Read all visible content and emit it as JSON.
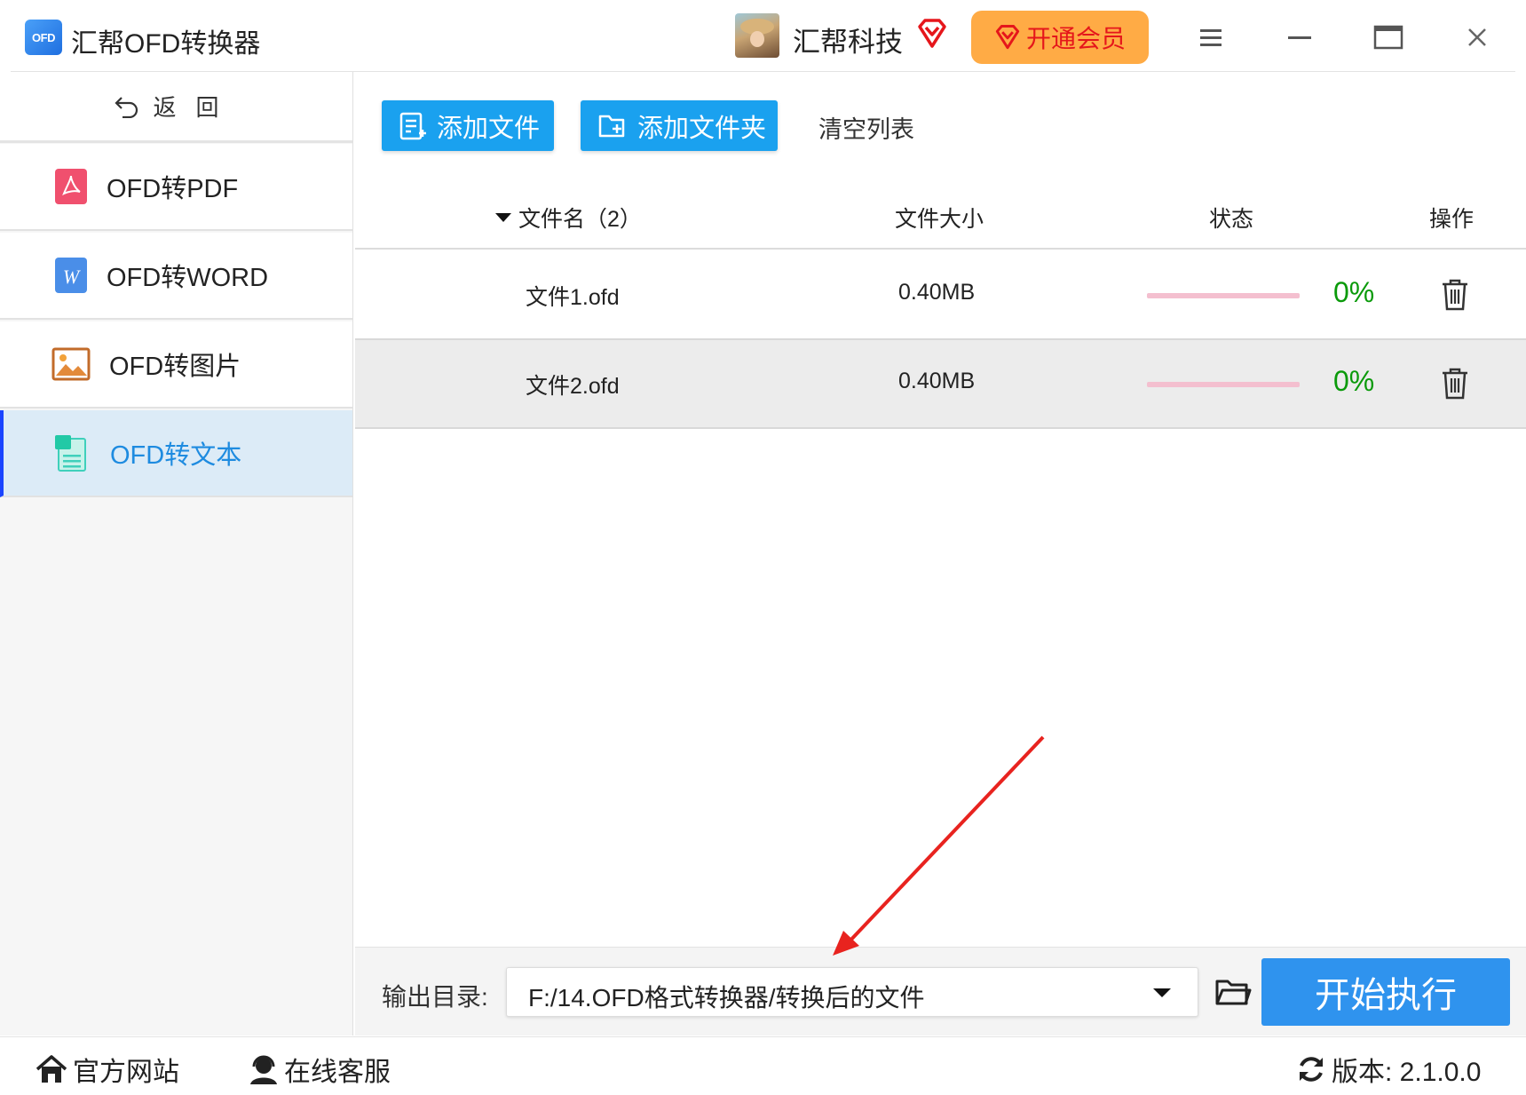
{
  "titlebar": {
    "logo_text": "OFD",
    "app_title": "汇帮OFD转换器",
    "user_name": "汇帮科技",
    "vip_label": "开通会员"
  },
  "sidebar": {
    "back_label": "返回",
    "items": [
      {
        "label": "OFD转PDF",
        "icon": "pdf-icon",
        "active": false
      },
      {
        "label": "OFD转WORD",
        "icon": "word-icon",
        "active": false
      },
      {
        "label": "OFD转图片",
        "icon": "image-icon",
        "active": false
      },
      {
        "label": "OFD转文本",
        "icon": "text-doc-icon",
        "active": true
      }
    ]
  },
  "toolbar": {
    "add_file": "添加文件",
    "add_folder": "添加文件夹",
    "clear_list": "清空列表"
  },
  "table": {
    "headers": {
      "name": "文件名（2）",
      "size": "文件大小",
      "status": "状态",
      "action": "操作"
    },
    "rows": [
      {
        "name": "文件1.ofd",
        "size": "0.40MB",
        "progress_fraction": 0,
        "percent": "0%"
      },
      {
        "name": "文件2.ofd",
        "size": "0.40MB",
        "progress_fraction": 0,
        "percent": "0%"
      }
    ]
  },
  "output": {
    "label": "输出目录:",
    "path": "F:/14.OFD格式转换器/转换后的文件",
    "start_label": "开始执行"
  },
  "footer": {
    "website": "官方网站",
    "support": "在线客服",
    "version": "版本: 2.1.0.0"
  },
  "colors": {
    "accent": "#1aa1ef",
    "start_button": "#2f93ee",
    "vip_button": "#ffab45",
    "vip_text": "#e5161b",
    "active_nav_bg": "#dcebf7",
    "progress_track": "#f4bfcf",
    "percent_text": "#0a9a0a"
  }
}
